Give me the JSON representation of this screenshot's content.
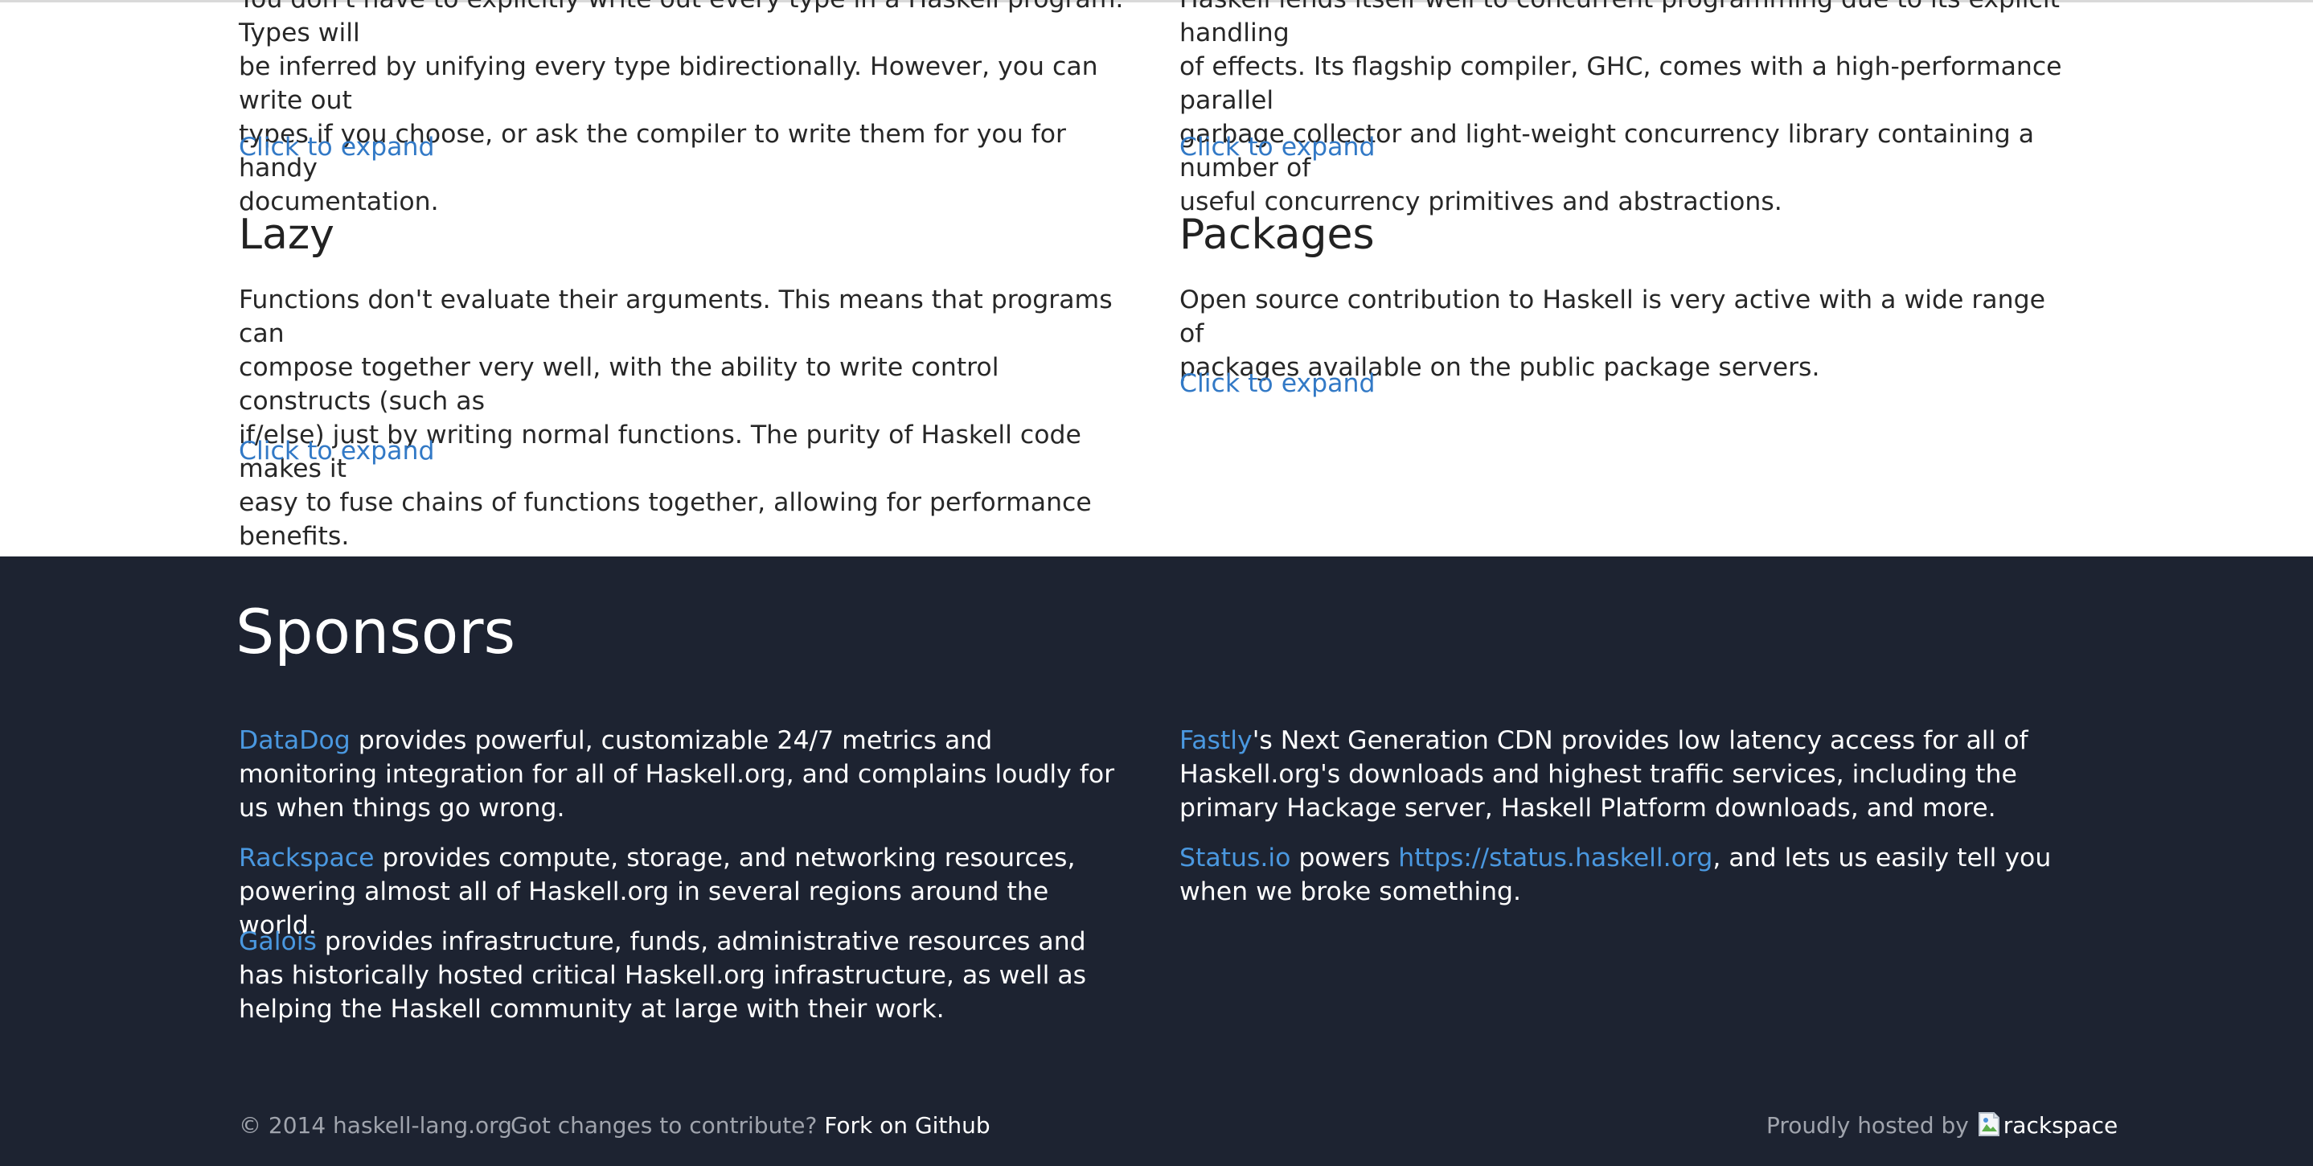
{
  "features": {
    "left_top": {
      "text": "You don't have to explicitly write out every type in a Haskell program. Types will\nbe inferred by unifying every type bidirectionally. However, you can write out\ntypes if you choose, or ask the compiler to write them for you for handy\ndocumentation.",
      "expand": "Click to expand"
    },
    "right_top": {
      "text": "Haskell lends itself well to concurrent programming due to its explicit handling\nof effects. Its flagship compiler, GHC, comes with a high-performance parallel\ngarbage collector and light-weight concurrency library containing a number of\nuseful concurrency primitives and abstractions.",
      "expand": "Click to expand"
    },
    "lazy": {
      "heading": "Lazy",
      "text": "Functions don't evaluate their arguments. This means that programs can\ncompose together very well, with the ability to write control constructs (such as\nif/else) just by writing normal functions. The purity of Haskell code makes it\neasy to fuse chains of functions together, allowing for performance benefits.",
      "expand": "Click to expand"
    },
    "packages": {
      "heading": "Packages",
      "text": "Open source contribution to Haskell is very active with a wide range of\npackages available on the public package servers.",
      "expand": "Click to expand"
    }
  },
  "sponsors": {
    "title": "Sponsors",
    "datadog": {
      "link": "DataDog",
      "text": " provides powerful, customizable 24/7 metrics and monitoring integration for all of Haskell.org, and complains loudly for us when things go wrong."
    },
    "rackspace": {
      "link": "Rackspace",
      "text": " provides compute, storage, and networking resources, powering almost all of Haskell.org in several regions around the world."
    },
    "galois": {
      "link": "Galois",
      "text": " provides infrastructure, funds, administrative resources and has historically hosted critical Haskell.org infrastructure, as well as helping the Haskell community at large with their work."
    },
    "fastly": {
      "link": "Fastly",
      "text": "'s Next Generation CDN provides low latency access for all of Haskell.org's downloads and highest traffic services, including the primary Hackage server, Haskell Platform downloads, and more."
    },
    "statusio": {
      "link": "Status.io",
      "text_before": " powers ",
      "url": "https://status.haskell.org",
      "text_after": ", and lets us easily tell you when we broke something."
    }
  },
  "footer": {
    "copyright": "© 2014 haskell-lang.org",
    "contribute_prompt": "Got changes to contribute?",
    "fork_link": "Fork on Github",
    "hosted_by": "Proudly hosted by",
    "hosted_logo_alt": "rackspace"
  },
  "colors": {
    "link": "#3279c6",
    "sponsor_link": "#4a98e0",
    "sponsors_background": "#1d2331",
    "body_text": "#272727"
  }
}
